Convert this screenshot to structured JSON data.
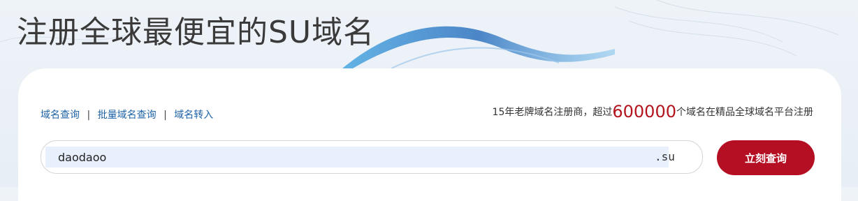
{
  "hero": {
    "title": "注册全球最便宜的SU域名"
  },
  "tabs": {
    "domain_query": "域名查询",
    "batch_query": "批量域名查询",
    "domain_transfer": "域名转入",
    "separator": "|"
  },
  "promo": {
    "prefix": "15年老牌域名注册商，超过",
    "count": "600000",
    "suffix": "个域名在精品全球域名平台注册"
  },
  "search": {
    "value": "daodaoo",
    "suffix": ".su",
    "button_label": "立刻查询"
  },
  "colors": {
    "accent": "#b40f22",
    "link": "#1e63a8",
    "highlight": "#b4141e"
  }
}
